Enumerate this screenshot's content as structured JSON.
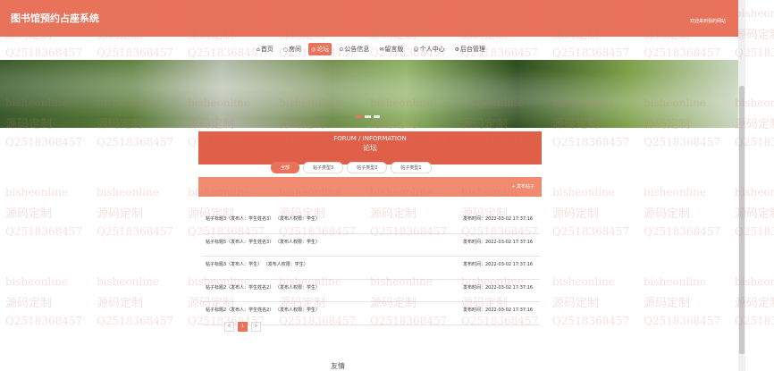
{
  "header": {
    "title": "图书馆预约占座系统",
    "welcome": "欢迎来到我的网站"
  },
  "nav": {
    "items": [
      {
        "icon": "⌂",
        "label": "首页"
      },
      {
        "icon": "○",
        "label": "房间"
      },
      {
        "icon": "◎",
        "label": "论坛"
      },
      {
        "icon": "⊙",
        "label": "公告信息"
      },
      {
        "icon": "✉",
        "label": "留言版"
      },
      {
        "icon": "☺",
        "label": "个人中心"
      },
      {
        "icon": "⚙",
        "label": "后台管理"
      }
    ]
  },
  "forum": {
    "title_en": "FORUM / INFORMATION",
    "title_cn": "论坛",
    "filters": [
      "全部",
      "帖子类型3",
      "帖子类型2",
      "帖子类型1"
    ],
    "post_button": "+ 发布帖子",
    "posts": [
      {
        "title": "帖子标题3（发布人：学生姓名3） （发布人权限：学生）",
        "date": "发布时间：2022-03-02 17:37:16"
      },
      {
        "title": "帖子标题5（发布人：学生姓名3） （发布人权限：学生）",
        "date": "发布时间：2022-03-02 17:37:16"
      },
      {
        "title": "帖子标题3（发布人：学生） （发布人权限：学生）",
        "date": "发布时间：2022-03-02 17:37:16"
      },
      {
        "title": "帖子标题2（发布人：学生姓名2） （发布人权限：学生）",
        "date": "发布时间：2022-03-02 17:37:16"
      },
      {
        "title": "帖子标题2（发布人：学生姓名2） （发布人权限：学生）",
        "date": "发布时间：2022-03-02 17:37:16"
      }
    ],
    "pager": [
      "<",
      "1",
      ">"
    ]
  },
  "watermark": {
    "site": "bisheonline",
    "brand": "源码定制",
    "qq": "Q2518368457"
  },
  "footer": "友情"
}
